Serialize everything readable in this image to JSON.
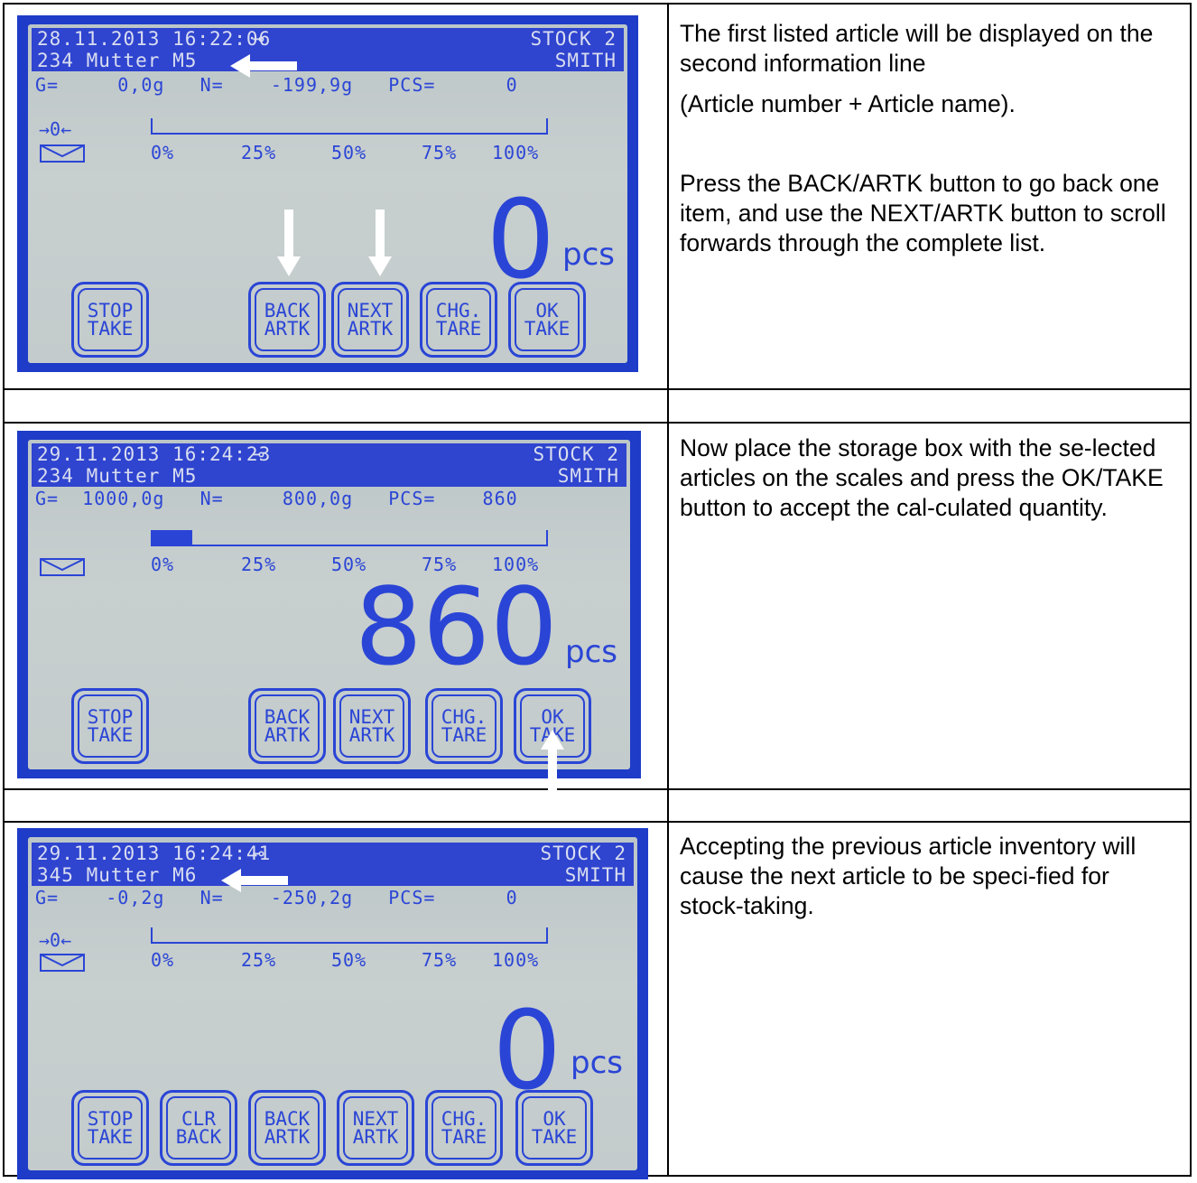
{
  "rows": [
    {
      "screen": {
        "datetime": "28.11.2013 16:22:06",
        "stock": "STOCK 2",
        "article": "234 Mutter M5",
        "user": "SMITH",
        "info": "G=     0,0g   N=    -199,9g   PCS=      0",
        "zero_symbol": "→0←",
        "fill_percent": 0,
        "ticks": [
          "0%",
          "25%",
          "50%",
          "75%",
          "100%"
        ],
        "quantity": "0",
        "unit": "pcs",
        "buttons": [
          {
            "line1": "STOP",
            "line2": "TAKE"
          },
          {
            "line1": "BACK",
            "line2": "ARTK"
          },
          {
            "line1": "NEXT",
            "line2": "ARTK"
          },
          {
            "line1": "CHG.",
            "line2": "TARE"
          },
          {
            "line1": "OK",
            "line2": "TAKE"
          }
        ]
      },
      "description": [
        "The first listed article will be displayed on the second information line",
        "(Article number + Article name).",
        "Press the BACK/ARTK button to go back one item, and use the NEXT/ARTK button to scroll forwards through the complete  list."
      ]
    },
    {
      "screen": {
        "datetime": "29.11.2013 16:24:23",
        "stock": "STOCK 2",
        "article": "234 Mutter M5",
        "user": "SMITH",
        "info": "G=  1000,0g   N=     800,0g   PCS=    860",
        "fill_percent": 10,
        "ticks": [
          "0%",
          "25%",
          "50%",
          "75%",
          "100%"
        ],
        "quantity": "860",
        "unit": "pcs",
        "buttons": [
          {
            "line1": "STOP",
            "line2": "TAKE"
          },
          {
            "line1": "BACK",
            "line2": "ARTK"
          },
          {
            "line1": "NEXT",
            "line2": "ARTK"
          },
          {
            "line1": "CHG.",
            "line2": "TARE"
          },
          {
            "line1": "OK",
            "line2": "TAKE"
          }
        ]
      },
      "description": [
        "Now place the storage box with the se-lected articles on the scales and press the OK/TAKE button to accept the cal-culated quantity."
      ]
    },
    {
      "screen": {
        "datetime": "29.11.2013 16:24:41",
        "stock": "STOCK 2",
        "article": "345 Mutter M6",
        "user": "SMITH",
        "info": "G=    -0,2g   N=    -250,2g   PCS=      0",
        "zero_symbol": "→0←",
        "fill_percent": 0,
        "ticks": [
          "0%",
          "25%",
          "50%",
          "75%",
          "100%"
        ],
        "quantity": "0",
        "unit": "pcs",
        "buttons": [
          {
            "line1": "STOP",
            "line2": "TAKE"
          },
          {
            "line1": "CLR",
            "line2": "BACK"
          },
          {
            "line1": "BACK",
            "line2": "ARTK"
          },
          {
            "line1": "NEXT",
            "line2": "ARTK"
          },
          {
            "line1": "CHG.",
            "line2": "TARE"
          },
          {
            "line1": "OK",
            "line2": "TAKE"
          }
        ]
      },
      "description": [
        "Accepting the previous article inventory will cause the next article to be speci-fied for stock-taking."
      ]
    }
  ],
  "colors": {
    "lcd_frame": "#1e3cc8",
    "lcd_text": "#2a45d6",
    "lcd_background": "#c3cbcc"
  }
}
